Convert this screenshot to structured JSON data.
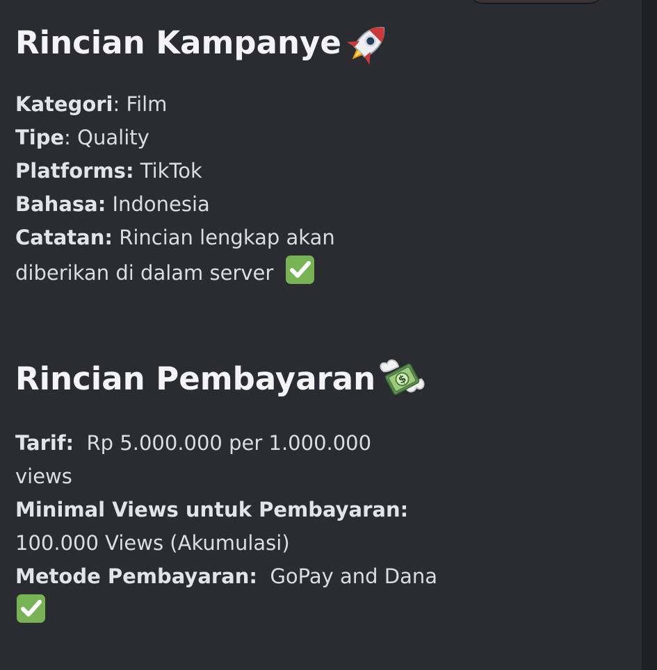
{
  "campaign": {
    "title": "Rincian Kampanye",
    "title_icon": "rocket-icon",
    "details": [
      {
        "label": "Kategori",
        "separator": ": ",
        "value": "Film"
      },
      {
        "label": "Tipe",
        "separator": ": ",
        "value": "Quality"
      },
      {
        "label": "Platforms:",
        "separator": " ",
        "value": "TikTok"
      },
      {
        "label": "Bahasa:",
        "separator": "  ",
        "value": "Indonesia"
      },
      {
        "label": "Catatan:",
        "separator": " ",
        "value": "Rincian lengkap akan"
      }
    ],
    "note_continuation": "diberikan di dalam server",
    "note_icon": "check-mark-button-icon"
  },
  "payment": {
    "title": "Rincian Pembayaran",
    "title_icon": "money-with-wings-icon",
    "rate_label": "Tarif:",
    "rate_value": "Rp 5.000.000 per 1.000.000",
    "rate_continuation": "views",
    "minimum_label": "Minimal Views untuk Pembayaran:",
    "minimum_value": "100.000 Views (Akumulasi)",
    "method_label": "Metode Pembayaran:",
    "method_value": "GoPay and Dana",
    "method_icon": "check-mark-button-icon"
  },
  "colors": {
    "background": "#2b2c32",
    "text": "#dcdde2",
    "heading": "#f4f4f6",
    "check_green": "#77b255"
  }
}
